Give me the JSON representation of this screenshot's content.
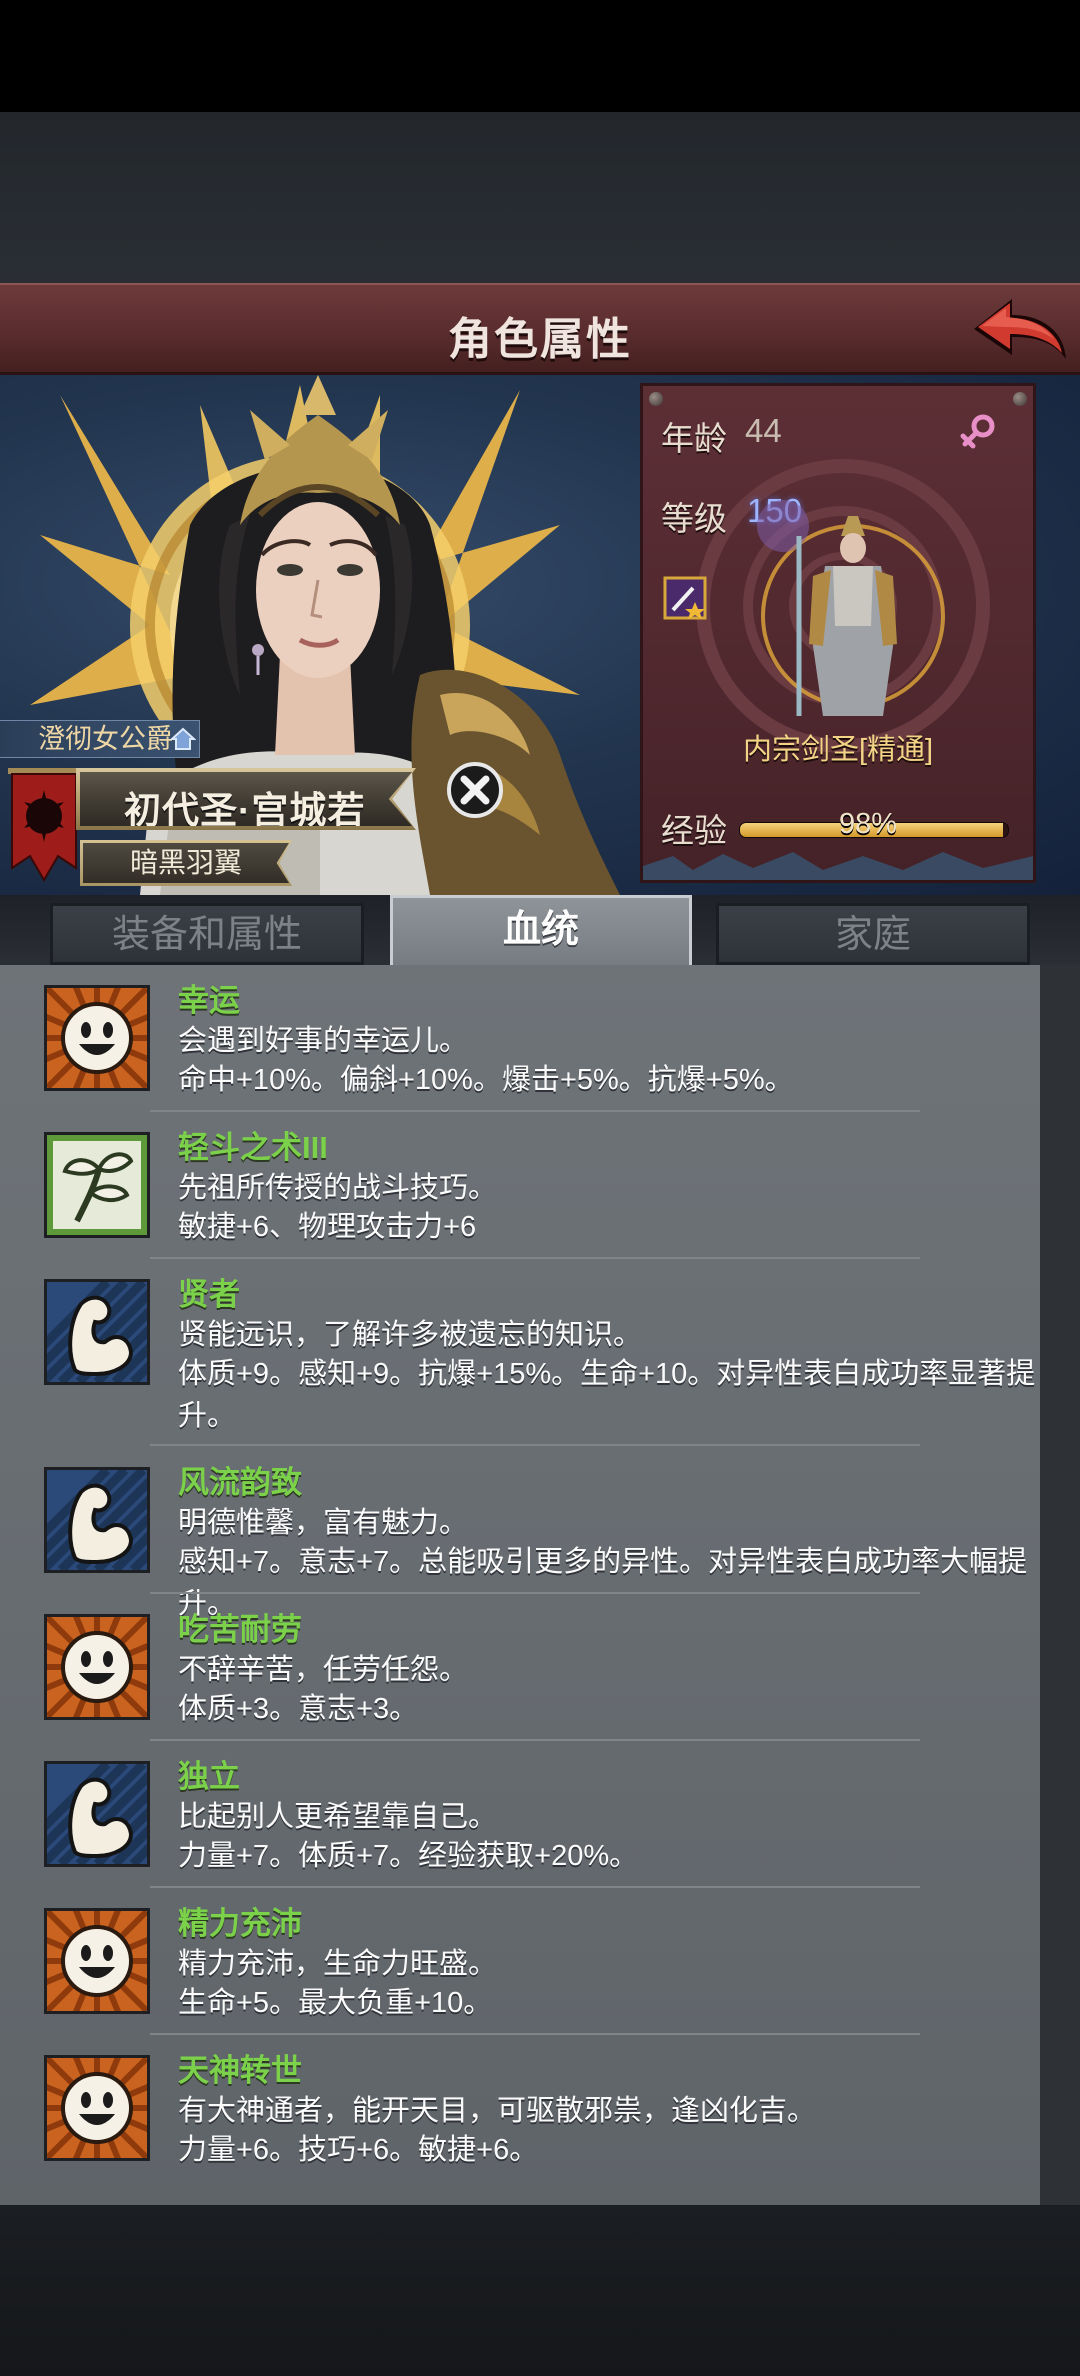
{
  "header": {
    "title": "角色属性"
  },
  "character": {
    "noble_title": "澄彻女公爵",
    "name": "初代圣·宫城若",
    "subtitle": "暗黑羽翼",
    "age_label": "年龄",
    "age": "44",
    "level_label": "等级",
    "level": "150",
    "class_name": "内宗剑圣[精通]",
    "exp_label": "经验",
    "exp_percent_text": "98%",
    "exp_fraction": 0.98
  },
  "tabs": [
    {
      "label": "装备和属性"
    },
    {
      "label": "血统"
    },
    {
      "label": "家庭"
    }
  ],
  "active_tab": "血统",
  "traits": [
    {
      "icon": "smiley-icon",
      "name": "幸运",
      "desc": "会遇到好事的幸运儿。",
      "effect": "命中+10%。偏斜+10%。爆击+5%。抗爆+5%。"
    },
    {
      "icon": "leaf-icon",
      "name": "轻斗之术III",
      "desc": "先祖所传授的战斗技巧。",
      "effect": "敏捷+6、物理攻击力+6"
    },
    {
      "icon": "muscle-arm-icon",
      "name": "贤者",
      "desc": "贤能远识，了解许多被遗忘的知识。",
      "effect": "体质+9。感知+9。抗爆+15%。生命+10。对异性表白成功率显著提升。"
    },
    {
      "icon": "muscle-arm-icon",
      "name": "风流韵致",
      "desc": "明德惟馨，富有魅力。",
      "effect": "感知+7。意志+7。总能吸引更多的异性。对异性表白成功率大幅提升。"
    },
    {
      "icon": "smiley-icon",
      "name": "吃苦耐劳",
      "desc": "不辞辛苦，任劳任怨。",
      "effect": "体质+3。意志+3。"
    },
    {
      "icon": "muscle-arm-icon",
      "name": "独立",
      "desc": "比起别人更希望靠自己。",
      "effect": "力量+7。体质+7。经验获取+20%。"
    },
    {
      "icon": "smiley-icon",
      "name": "精力充沛",
      "desc": "精力充沛，生命力旺盛。",
      "effect": "生命+5。最大负重+10。"
    },
    {
      "icon": "smiley-icon",
      "name": "天神转世",
      "desc": "有大神通者，能开天目，可驱散邪祟，逢凶化吉。",
      "effect": "力量+6。技巧+6。敏捷+6。"
    }
  ],
  "colors": {
    "trait_name": "#7bd24a",
    "header_bg": "#5a2c2e",
    "level_value": "#9fb6ff",
    "class_name": "#f3d486"
  }
}
